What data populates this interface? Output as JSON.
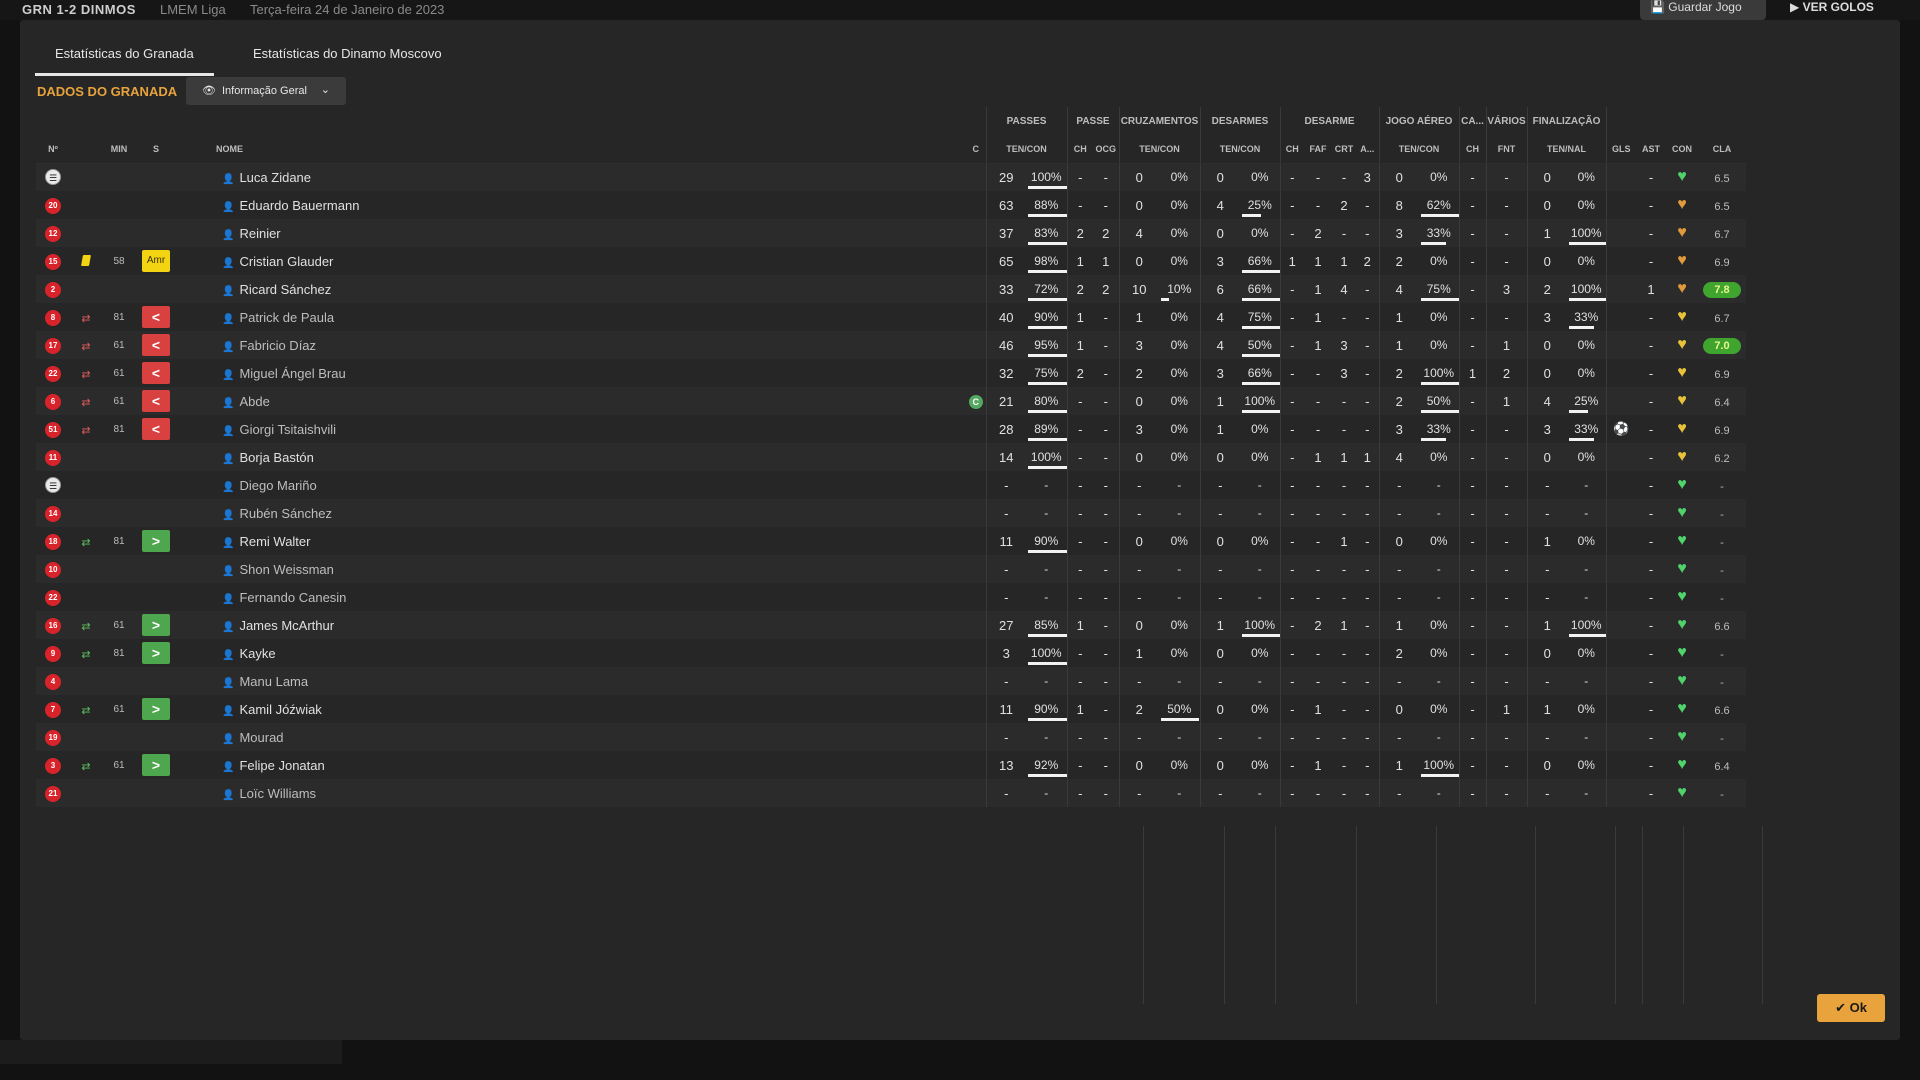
{
  "topbar": {
    "score": "GRN 1-2 DINMOS",
    "competition": "LMEM Liga",
    "date": "Terça-feira 24 de Janeiro de 2023",
    "save": "Guardar Jogo",
    "video": "VER GOLOS"
  },
  "tabs": [
    "Estatísticas do Granada",
    "Estatísticas do Dinamo Moscovo"
  ],
  "section_title": "DADOS DO GRANADA",
  "view_select": "Informação Geral",
  "ok": "Ok",
  "colors": {
    "accent": "#e8a33d",
    "sub_out": "#d94040",
    "sub_in": "#4ea64e",
    "yellow": "#f2d413",
    "home": "#d9232b",
    "heart_green": "#4fd36a",
    "rating_high": "#3fa52f"
  },
  "groups": [
    "PASSES",
    "PASSE",
    "CRUZAMENTOS",
    "DESARMES",
    "DESARME",
    "JOGO AÉREO",
    "CA...",
    "VÁRIOS",
    "FINALIZAÇÃO"
  ],
  "headers": {
    "num": "Nº",
    "min": "MIN",
    "s": "S",
    "name": "NOME",
    "c": "C",
    "pass_tc": "TEN/CON",
    "pass_ch": "CH",
    "pass_ocg": "OCG",
    "cross_tc": "TEN/CON",
    "tack_tc": "TEN/CON",
    "tack_ch": "CH",
    "tack_faf": "FAF",
    "tack_crt": "CRT",
    "tack_a": "A...",
    "air_tc": "TEN/CON",
    "ca_ch": "CH",
    "var_fnt": "FNT",
    "fin_tn": "TEN/NAL",
    "gls": "GLS",
    "ast": "AST",
    "con": "CON",
    "cla": "CLA"
  },
  "players": [
    {
      "num": "",
      "gk": true,
      "card": "",
      "sub": "",
      "min": "",
      "status": "",
      "name": "Luca Zidane",
      "c": "",
      "p": [
        "29",
        "100%",
        100
      ],
      "pch": "-",
      "pocg": "-",
      "x": [
        "0",
        "0%",
        0
      ],
      "t": [
        "0",
        "0%",
        0
      ],
      "tch": "-",
      "faf": "-",
      "crt": "-",
      "ta": "3",
      "a": [
        "0",
        "0%",
        0
      ],
      "cach": "-",
      "fnt": "-",
      "f": [
        "0",
        "0%",
        0
      ],
      "gls": "",
      "ast": "-",
      "con": "g",
      "cla": "6.5",
      "hi": false,
      "dim": false
    },
    {
      "num": "20",
      "gk": false,
      "card": "",
      "sub": "",
      "min": "",
      "status": "",
      "name": "Eduardo Bauermann",
      "c": "",
      "p": [
        "63",
        "88%",
        88
      ],
      "pch": "-",
      "pocg": "-",
      "x": [
        "0",
        "0%",
        0
      ],
      "t": [
        "4",
        "25%",
        25
      ],
      "tch": "-",
      "faf": "-",
      "crt": "2",
      "ta": "-",
      "a": [
        "8",
        "62%",
        62
      ],
      "cach": "-",
      "fnt": "-",
      "f": [
        "0",
        "0%",
        0
      ],
      "gls": "",
      "ast": "-",
      "con": "o",
      "cla": "6.5",
      "hi": false,
      "dim": false
    },
    {
      "num": "12",
      "gk": false,
      "card": "",
      "sub": "",
      "min": "",
      "status": "",
      "name": "Reinier",
      "c": "",
      "p": [
        "37",
        "83%",
        83
      ],
      "pch": "2",
      "pocg": "2",
      "x": [
        "4",
        "0%",
        0
      ],
      "t": [
        "0",
        "0%",
        0
      ],
      "tch": "-",
      "faf": "2",
      "crt": "-",
      "ta": "-",
      "a": [
        "3",
        "33%",
        33
      ],
      "cach": "-",
      "fnt": "-",
      "f": [
        "1",
        "100%",
        100
      ],
      "gls": "",
      "ast": "-",
      "con": "o",
      "cla": "6.7",
      "hi": false,
      "dim": false
    },
    {
      "num": "15",
      "gk": false,
      "card": "y",
      "sub": "",
      "min": "58",
      "status": "amr",
      "name": "Cristian Glauder",
      "c": "",
      "p": [
        "65",
        "98%",
        98
      ],
      "pch": "1",
      "pocg": "1",
      "x": [
        "0",
        "0%",
        0
      ],
      "t": [
        "3",
        "66%",
        66
      ],
      "tch": "1",
      "faf": "1",
      "crt": "1",
      "ta": "2",
      "a": [
        "2",
        "0%",
        0
      ],
      "cach": "-",
      "fnt": "-",
      "f": [
        "0",
        "0%",
        0
      ],
      "gls": "",
      "ast": "-",
      "con": "o",
      "cla": "6.9",
      "hi": false,
      "dim": false
    },
    {
      "num": "2",
      "gk": false,
      "card": "",
      "sub": "",
      "min": "",
      "status": "",
      "name": "Ricard Sánchez",
      "c": "",
      "p": [
        "33",
        "72%",
        72
      ],
      "pch": "2",
      "pocg": "2",
      "x": [
        "10",
        "10%",
        10
      ],
      "t": [
        "6",
        "66%",
        66
      ],
      "tch": "-",
      "faf": "1",
      "crt": "4",
      "ta": "-",
      "a": [
        "4",
        "75%",
        75
      ],
      "cach": "-",
      "fnt": "3",
      "f": [
        "2",
        "100%",
        100
      ],
      "gls": "",
      "ast": "1",
      "con": "o",
      "cla": "7.8",
      "hi": true,
      "dim": false
    },
    {
      "num": "8",
      "gk": false,
      "card": "",
      "sub": "out",
      "min": "81",
      "status": "out",
      "name": "Patrick de Paula",
      "c": "",
      "p": [
        "40",
        "90%",
        90
      ],
      "pch": "1",
      "pocg": "-",
      "x": [
        "1",
        "0%",
        0
      ],
      "t": [
        "4",
        "75%",
        75
      ],
      "tch": "-",
      "faf": "1",
      "crt": "-",
      "ta": "-",
      "a": [
        "1",
        "0%",
        0
      ],
      "cach": "-",
      "fnt": "-",
      "f": [
        "3",
        "33%",
        33
      ],
      "gls": "",
      "ast": "-",
      "con": "y",
      "cla": "6.7",
      "hi": false,
      "dim": true
    },
    {
      "num": "17",
      "gk": false,
      "card": "",
      "sub": "out",
      "min": "61",
      "status": "out",
      "name": "Fabricio Díaz",
      "c": "",
      "p": [
        "46",
        "95%",
        95
      ],
      "pch": "1",
      "pocg": "-",
      "x": [
        "3",
        "0%",
        0
      ],
      "t": [
        "4",
        "50%",
        50
      ],
      "tch": "-",
      "faf": "1",
      "crt": "3",
      "ta": "-",
      "a": [
        "1",
        "0%",
        0
      ],
      "cach": "-",
      "fnt": "1",
      "f": [
        "0",
        "0%",
        0
      ],
      "gls": "",
      "ast": "-",
      "con": "y",
      "cla": "7.0",
      "hi": true,
      "dim": true
    },
    {
      "num": "22",
      "gk": false,
      "card": "",
      "sub": "out",
      "min": "61",
      "status": "out",
      "name": "Miguel Ángel Brau",
      "c": "",
      "p": [
        "32",
        "75%",
        75
      ],
      "pch": "2",
      "pocg": "-",
      "x": [
        "2",
        "0%",
        0
      ],
      "t": [
        "3",
        "66%",
        66
      ],
      "tch": "-",
      "faf": "-",
      "crt": "3",
      "ta": "-",
      "a": [
        "2",
        "100%",
        100
      ],
      "cach": "1",
      "fnt": "2",
      "f": [
        "0",
        "0%",
        0
      ],
      "gls": "",
      "ast": "-",
      "con": "y",
      "cla": "6.9",
      "hi": false,
      "dim": true
    },
    {
      "num": "6",
      "gk": false,
      "card": "",
      "sub": "out",
      "min": "61",
      "status": "out",
      "name": "Abde",
      "c": "C",
      "p": [
        "21",
        "80%",
        80
      ],
      "pch": "-",
      "pocg": "-",
      "x": [
        "0",
        "0%",
        0
      ],
      "t": [
        "1",
        "100%",
        100
      ],
      "tch": "-",
      "faf": "-",
      "crt": "-",
      "ta": "-",
      "a": [
        "2",
        "50%",
        50
      ],
      "cach": "-",
      "fnt": "1",
      "f": [
        "4",
        "25%",
        25
      ],
      "gls": "",
      "ast": "-",
      "con": "y",
      "cla": "6.4",
      "hi": false,
      "dim": true
    },
    {
      "num": "51",
      "gk": false,
      "card": "",
      "sub": "out",
      "min": "81",
      "status": "out",
      "name": "Giorgi Tsitaishvili",
      "c": "",
      "p": [
        "28",
        "89%",
        89
      ],
      "pch": "-",
      "pocg": "-",
      "x": [
        "3",
        "0%",
        0
      ],
      "t": [
        "1",
        "0%",
        0
      ],
      "tch": "-",
      "faf": "-",
      "crt": "-",
      "ta": "-",
      "a": [
        "3",
        "33%",
        33
      ],
      "cach": "-",
      "fnt": "-",
      "f": [
        "3",
        "33%",
        33
      ],
      "gls": "⚽",
      "ast": "-",
      "con": "y",
      "cla": "6.9",
      "hi": false,
      "dim": true
    },
    {
      "num": "11",
      "gk": false,
      "card": "",
      "sub": "",
      "min": "",
      "status": "",
      "name": "Borja Bastón",
      "c": "",
      "p": [
        "14",
        "100%",
        100
      ],
      "pch": "-",
      "pocg": "-",
      "x": [
        "0",
        "0%",
        0
      ],
      "t": [
        "0",
        "0%",
        0
      ],
      "tch": "-",
      "faf": "1",
      "crt": "1",
      "ta": "1",
      "a": [
        "4",
        "0%",
        0
      ],
      "cach": "-",
      "fnt": "-",
      "f": [
        "0",
        "0%",
        0
      ],
      "gls": "",
      "ast": "-",
      "con": "y",
      "cla": "6.2",
      "hi": false,
      "dim": false
    },
    {
      "num": "",
      "gk": true,
      "card": "",
      "sub": "",
      "min": "",
      "status": "",
      "name": "Diego Mariño",
      "c": "",
      "p": [
        "-",
        "-",
        0
      ],
      "pch": "-",
      "pocg": "-",
      "x": [
        "-",
        "-",
        0
      ],
      "t": [
        "-",
        "-",
        0
      ],
      "tch": "-",
      "faf": "-",
      "crt": "-",
      "ta": "-",
      "a": [
        "-",
        "-",
        0
      ],
      "cach": "-",
      "fnt": "-",
      "f": [
        "-",
        "-",
        0
      ],
      "gls": "",
      "ast": "-",
      "con": "g",
      "cla": "-",
      "hi": false,
      "dim": true
    },
    {
      "num": "14",
      "gk": false,
      "card": "",
      "sub": "",
      "min": "",
      "status": "",
      "name": "Rubén Sánchez",
      "c": "",
      "p": [
        "-",
        "-",
        0
      ],
      "pch": "-",
      "pocg": "-",
      "x": [
        "-",
        "-",
        0
      ],
      "t": [
        "-",
        "-",
        0
      ],
      "tch": "-",
      "faf": "-",
      "crt": "-",
      "ta": "-",
      "a": [
        "-",
        "-",
        0
      ],
      "cach": "-",
      "fnt": "-",
      "f": [
        "-",
        "-",
        0
      ],
      "gls": "",
      "ast": "-",
      "con": "g",
      "cla": "-",
      "hi": false,
      "dim": true
    },
    {
      "num": "18",
      "gk": false,
      "card": "",
      "sub": "in",
      "min": "81",
      "status": "in",
      "name": "Remi Walter",
      "c": "",
      "p": [
        "11",
        "90%",
        90
      ],
      "pch": "-",
      "pocg": "-",
      "x": [
        "0",
        "0%",
        0
      ],
      "t": [
        "0",
        "0%",
        0
      ],
      "tch": "-",
      "faf": "-",
      "crt": "1",
      "ta": "-",
      "a": [
        "0",
        "0%",
        0
      ],
      "cach": "-",
      "fnt": "-",
      "f": [
        "1",
        "0%",
        0
      ],
      "gls": "",
      "ast": "-",
      "con": "g",
      "cla": "-",
      "hi": false,
      "dim": false
    },
    {
      "num": "10",
      "gk": false,
      "card": "",
      "sub": "",
      "min": "",
      "status": "",
      "name": "Shon Weissman",
      "c": "",
      "p": [
        "-",
        "-",
        0
      ],
      "pch": "-",
      "pocg": "-",
      "x": [
        "-",
        "-",
        0
      ],
      "t": [
        "-",
        "-",
        0
      ],
      "tch": "-",
      "faf": "-",
      "crt": "-",
      "ta": "-",
      "a": [
        "-",
        "-",
        0
      ],
      "cach": "-",
      "fnt": "-",
      "f": [
        "-",
        "-",
        0
      ],
      "gls": "",
      "ast": "-",
      "con": "g",
      "cla": "-",
      "hi": false,
      "dim": true
    },
    {
      "num": "22",
      "gk": false,
      "card": "",
      "sub": "",
      "min": "",
      "status": "",
      "name": "Fernando Canesin",
      "c": "",
      "p": [
        "-",
        "-",
        0
      ],
      "pch": "-",
      "pocg": "-",
      "x": [
        "-",
        "-",
        0
      ],
      "t": [
        "-",
        "-",
        0
      ],
      "tch": "-",
      "faf": "-",
      "crt": "-",
      "ta": "-",
      "a": [
        "-",
        "-",
        0
      ],
      "cach": "-",
      "fnt": "-",
      "f": [
        "-",
        "-",
        0
      ],
      "gls": "",
      "ast": "-",
      "con": "g",
      "cla": "-",
      "hi": false,
      "dim": true
    },
    {
      "num": "16",
      "gk": false,
      "card": "",
      "sub": "in",
      "min": "61",
      "status": "in",
      "name": "James McArthur",
      "c": "",
      "p": [
        "27",
        "85%",
        85
      ],
      "pch": "1",
      "pocg": "-",
      "x": [
        "0",
        "0%",
        0
      ],
      "t": [
        "1",
        "100%",
        100
      ],
      "tch": "-",
      "faf": "2",
      "crt": "1",
      "ta": "-",
      "a": [
        "1",
        "0%",
        0
      ],
      "cach": "-",
      "fnt": "-",
      "f": [
        "1",
        "100%",
        100
      ],
      "gls": "",
      "ast": "-",
      "con": "g",
      "cla": "6.6",
      "hi": false,
      "dim": false
    },
    {
      "num": "9",
      "gk": false,
      "card": "",
      "sub": "in",
      "min": "81",
      "status": "in",
      "name": "Kayke",
      "c": "",
      "p": [
        "3",
        "100%",
        100
      ],
      "pch": "-",
      "pocg": "-",
      "x": [
        "1",
        "0%",
        0
      ],
      "t": [
        "0",
        "0%",
        0
      ],
      "tch": "-",
      "faf": "-",
      "crt": "-",
      "ta": "-",
      "a": [
        "2",
        "0%",
        0
      ],
      "cach": "-",
      "fnt": "-",
      "f": [
        "0",
        "0%",
        0
      ],
      "gls": "",
      "ast": "-",
      "con": "g",
      "cla": "-",
      "hi": false,
      "dim": false
    },
    {
      "num": "4",
      "gk": false,
      "card": "",
      "sub": "",
      "min": "",
      "status": "",
      "name": "Manu Lama",
      "c": "",
      "p": [
        "-",
        "-",
        0
      ],
      "pch": "-",
      "pocg": "-",
      "x": [
        "-",
        "-",
        0
      ],
      "t": [
        "-",
        "-",
        0
      ],
      "tch": "-",
      "faf": "-",
      "crt": "-",
      "ta": "-",
      "a": [
        "-",
        "-",
        0
      ],
      "cach": "-",
      "fnt": "-",
      "f": [
        "-",
        "-",
        0
      ],
      "gls": "",
      "ast": "-",
      "con": "g",
      "cla": "-",
      "hi": false,
      "dim": true
    },
    {
      "num": "7",
      "gk": false,
      "card": "",
      "sub": "in",
      "min": "61",
      "status": "in",
      "name": "Kamil Jóźwiak",
      "c": "",
      "p": [
        "11",
        "90%",
        90
      ],
      "pch": "1",
      "pocg": "-",
      "x": [
        "2",
        "50%",
        50
      ],
      "t": [
        "0",
        "0%",
        0
      ],
      "tch": "-",
      "faf": "1",
      "crt": "-",
      "ta": "-",
      "a": [
        "0",
        "0%",
        0
      ],
      "cach": "-",
      "fnt": "1",
      "f": [
        "1",
        "0%",
        0
      ],
      "gls": "",
      "ast": "-",
      "con": "g",
      "cla": "6.6",
      "hi": false,
      "dim": false
    },
    {
      "num": "19",
      "gk": false,
      "card": "",
      "sub": "",
      "min": "",
      "status": "",
      "name": "Mourad",
      "c": "",
      "p": [
        "-",
        "-",
        0
      ],
      "pch": "-",
      "pocg": "-",
      "x": [
        "-",
        "-",
        0
      ],
      "t": [
        "-",
        "-",
        0
      ],
      "tch": "-",
      "faf": "-",
      "crt": "-",
      "ta": "-",
      "a": [
        "-",
        "-",
        0
      ],
      "cach": "-",
      "fnt": "-",
      "f": [
        "-",
        "-",
        0
      ],
      "gls": "",
      "ast": "-",
      "con": "g",
      "cla": "-",
      "hi": false,
      "dim": true
    },
    {
      "num": "3",
      "gk": false,
      "card": "",
      "sub": "in",
      "min": "61",
      "status": "in",
      "name": "Felipe Jonatan",
      "c": "",
      "p": [
        "13",
        "92%",
        92
      ],
      "pch": "-",
      "pocg": "-",
      "x": [
        "0",
        "0%",
        0
      ],
      "t": [
        "0",
        "0%",
        0
      ],
      "tch": "-",
      "faf": "1",
      "crt": "-",
      "ta": "-",
      "a": [
        "1",
        "100%",
        100
      ],
      "cach": "-",
      "fnt": "-",
      "f": [
        "0",
        "0%",
        0
      ],
      "gls": "",
      "ast": "-",
      "con": "g",
      "cla": "6.4",
      "hi": false,
      "dim": false
    },
    {
      "num": "21",
      "gk": false,
      "card": "",
      "sub": "",
      "min": "",
      "status": "",
      "name": "Loïc Williams",
      "c": "",
      "p": [
        "-",
        "-",
        0
      ],
      "pch": "-",
      "pocg": "-",
      "x": [
        "-",
        "-",
        0
      ],
      "t": [
        "-",
        "-",
        0
      ],
      "tch": "-",
      "faf": "-",
      "crt": "-",
      "ta": "-",
      "a": [
        "-",
        "-",
        0
      ],
      "cach": "-",
      "fnt": "-",
      "f": [
        "-",
        "-",
        0
      ],
      "gls": "",
      "ast": "-",
      "con": "g",
      "cla": "-",
      "hi": false,
      "dim": true
    }
  ]
}
